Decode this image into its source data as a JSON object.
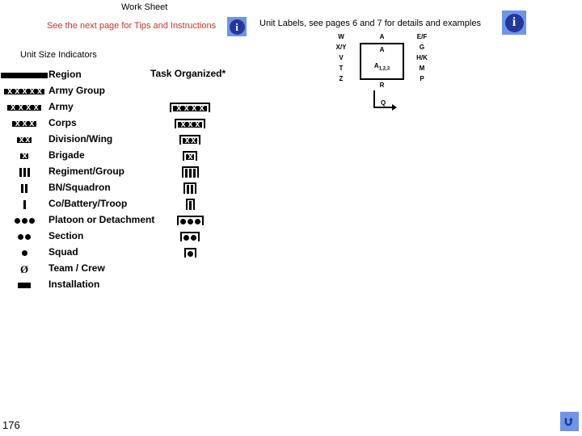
{
  "header": {
    "worksheet_title": "Work Sheet",
    "tips_note": "See the next page for Tips and Instructions",
    "tips_note_color": "#c0392b",
    "unit_labels_note": "Unit Labels, see pages 6 and 7 for details and examples",
    "info_icon_glyph": "i",
    "info_icon_name": "info-icon",
    "info_icon_bg": "#6e95e8",
    "info_icon_disc": "#24389c"
  },
  "unit_size": {
    "heading": "Unit Size Indicators",
    "task_org_heading": "Task Organized*",
    "rows": [
      {
        "label": "Region",
        "symbol": "XXXXXX",
        "task_organized": false
      },
      {
        "label": "Army Group",
        "symbol": "XXXXX",
        "task_organized": false
      },
      {
        "label": "Army",
        "symbol": "XXXX",
        "task_organized": true
      },
      {
        "label": "Corps",
        "symbol": "XXX",
        "task_organized": true
      },
      {
        "label": "Division/Wing",
        "symbol": "XX",
        "task_organized": true
      },
      {
        "label": "Brigade",
        "symbol": "X",
        "task_organized": true
      },
      {
        "label": "Regiment/Group",
        "symbol": "III",
        "task_organized": true
      },
      {
        "label": "BN/Squadron",
        "symbol": "II",
        "task_organized": true
      },
      {
        "label": "Co/Battery/Troop",
        "symbol": "I",
        "task_organized": true
      },
      {
        "label": "Platoon or Detachment",
        "symbol": "...",
        "task_organized": true
      },
      {
        "label": "Section",
        "symbol": "..",
        "task_organized": true
      },
      {
        "label": "Squad",
        "symbol": ".",
        "task_organized": true
      },
      {
        "label": "Team / Crew",
        "symbol": "O",
        "task_organized": false
      },
      {
        "label": "Installation",
        "symbol": "bar",
        "task_organized": false
      }
    ]
  },
  "unit_label_diagram": {
    "left_fields": [
      "W",
      "X/Y",
      "V",
      "T",
      "Z"
    ],
    "right_fields": [
      "E/F",
      "G",
      "H/K",
      "M",
      "P"
    ],
    "top_field": "A",
    "inside_top_field": "A",
    "inside_main_field": "A",
    "inside_main_subscript": "1,2,3",
    "bottom_field": "R",
    "arrow_field": "Q"
  },
  "footer": {
    "page_number": "176",
    "return_button_name": "return-arrow-icon",
    "return_button_bg": "#6e95e8"
  }
}
